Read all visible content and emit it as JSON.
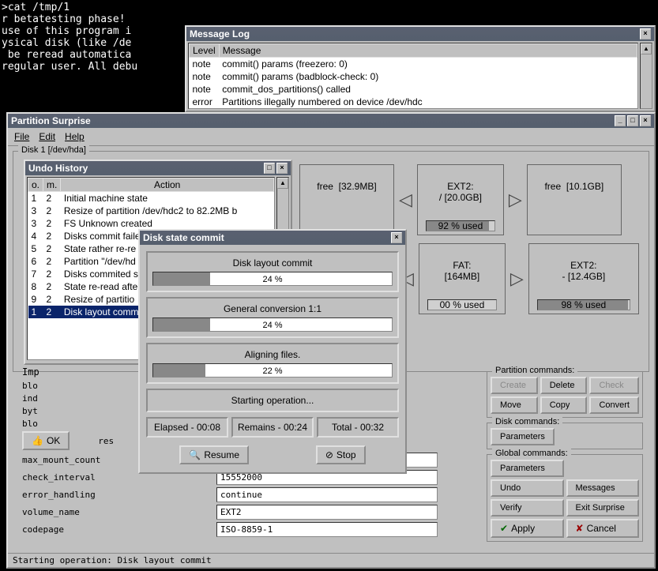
{
  "terminal": {
    "lines": [
      ">cat /tmp/1",
      "r betatesting phase!",
      "use of this program i",
      "ysical disk (like /de",
      " be reread automatica",
      "regular user. All debu"
    ]
  },
  "msglog": {
    "title": "Message Log",
    "cols": [
      "Level",
      "Message"
    ],
    "rows": [
      {
        "level": "note",
        "msg": "commit() params (freezero: 0)"
      },
      {
        "level": "note",
        "msg": "commit() params (badblock-check: 0)"
      },
      {
        "level": "note",
        "msg": "commit_dos_partitions() called"
      },
      {
        "level": "error",
        "msg": "Partitions illegally numbered on device /dev/hdc"
      }
    ]
  },
  "main": {
    "title": "Partition Surprise",
    "menu": [
      "File",
      "Edit",
      "Help"
    ],
    "disk1_label": "Disk 1 [/dev/hda]",
    "parts_row1": [
      {
        "l1": "free",
        "l2": "[32.9MB]",
        "used": null
      },
      {
        "l1": "EXT2:",
        "l2": "/ [20.0GB]",
        "used": "92 % used",
        "pct": 92
      },
      {
        "l1": "free",
        "l2": "[10.1GB]",
        "used": null
      }
    ],
    "parts_row2": [
      {
        "l1": "FAT:",
        "l2": "[164MB]",
        "used": "00 % used",
        "pct": 0
      },
      {
        "l1": "EXT2:",
        "l2": "- [12.4GB]",
        "used": "98 % used",
        "pct": 98
      }
    ],
    "partcmd_label": "Partition commands:",
    "partcmd": [
      "Create",
      "Delete",
      "Check",
      "Move",
      "Copy",
      "Convert"
    ],
    "diskcmd_label": "Disk commands:",
    "diskcmd": [
      "Parameters"
    ],
    "globcmd_label": "Global commands:",
    "globcmd": [
      "Parameters",
      "Undo",
      "Messages",
      "Verify",
      "Exit Surprise"
    ],
    "apply": "Apply",
    "cancel": "Cancel",
    "props": [
      {
        "k": "blo",
        "v": ""
      },
      {
        "k": "ind",
        "v": ""
      },
      {
        "k": "byt",
        "v": ""
      },
      {
        "k": "blo",
        "v": ""
      },
      {
        "k": "res",
        "v": ""
      },
      {
        "k": "max_mount_count",
        "v": ""
      },
      {
        "k": "check_interval",
        "v": "15552000"
      },
      {
        "k": "error_handling",
        "v": "continue"
      },
      {
        "k": "volume_name",
        "v": "EXT2"
      },
      {
        "k": "codepage",
        "v": "ISO-8859-1"
      }
    ],
    "imp_label": "Imp",
    "ok": "OK",
    "status": "Starting operation: Disk layout commit"
  },
  "undo": {
    "title": "Undo History",
    "cols": [
      "o.",
      "m.",
      "Action"
    ],
    "rows": [
      {
        "o": "1",
        "m": "2",
        "a": "Initial machine state"
      },
      {
        "o": "3",
        "m": "2",
        "a": "Resize of partition /dev/hdc2 to 82.2MB b"
      },
      {
        "o": "3",
        "m": "2",
        "a": "FS Unknown created"
      },
      {
        "o": "4",
        "m": "2",
        "a": "Disks commit faile"
      },
      {
        "o": "5",
        "m": "2",
        "a": "State rather re-re"
      },
      {
        "o": "6",
        "m": "2",
        "a": "Partition \"/dev/hd"
      },
      {
        "o": "7",
        "m": "2",
        "a": "Disks commited suc"
      },
      {
        "o": "8",
        "m": "2",
        "a": "State re-read afte"
      },
      {
        "o": "9",
        "m": "2",
        "a": "Resize of partitio"
      },
      {
        "o": "1",
        "m": "2",
        "a": "Disk layout commit",
        "sel": true
      }
    ]
  },
  "commit": {
    "title": "Disk state commit",
    "tasks": [
      {
        "label": "Disk layout commit",
        "pct": 24,
        "txt": "24 %"
      },
      {
        "label": "General conversion 1:1",
        "pct": 24,
        "txt": "24 %"
      },
      {
        "label": "Aligning files.",
        "pct": 22,
        "txt": "22 %"
      }
    ],
    "status": "Starting operation...",
    "elapsed": "Elapsed - 00:08",
    "remains": "Remains - 00:24",
    "total": "Total - 00:32",
    "resume": "Resume",
    "stop": "Stop"
  }
}
